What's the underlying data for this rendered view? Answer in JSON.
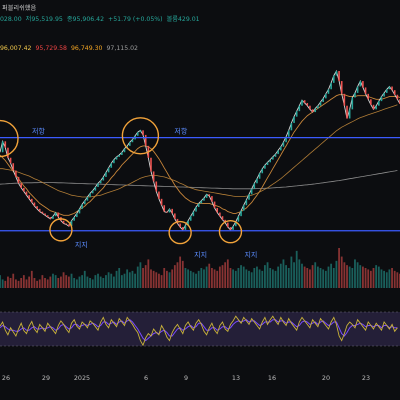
{
  "header": {
    "title_suffix": "퍼블리쉬했음",
    "ohlc": [
      {
        "text": "028.00",
        "color": "#26a69a"
      },
      {
        "text": "저95,519.95",
        "color": "#26a69a"
      },
      {
        "text": "종95,906.42",
        "color": "#26a69a"
      },
      {
        "text": "+51.79 (+0.05%)",
        "color": "#26a69a"
      },
      {
        "text": "볼륨429.01",
        "color": "#26a69a"
      }
    ],
    "ma_values": [
      {
        "text": "96,007.42",
        "color": "#f2c94c"
      },
      {
        "text": "95,729.58",
        "color": "#ef4444"
      },
      {
        "text": "96,749.30",
        "color": "#f5a623"
      },
      {
        "text": "97,115.02",
        "color": "#9e9e9e"
      }
    ]
  },
  "annotations": {
    "resistance_labels": [
      "저항",
      "저항"
    ],
    "support_labels": [
      "지지",
      "지지",
      "지지"
    ]
  },
  "colors": {
    "background": "#0c0d10",
    "up": "#26a69a",
    "down": "#ef5350",
    "level_line": "#3b5bff",
    "marker": "#f2a33a",
    "ma_orange": "#c9863a",
    "ma_gray": "#8d8d8d",
    "oscillator_band": "#2a2442",
    "oscillator_fast": "#c9b23a",
    "oscillator_slow": "#7a4cff"
  },
  "chart_data": {
    "type": "line",
    "x_tick_labels": [
      "26",
      "29",
      "2025",
      "6",
      "9",
      "13",
      "16",
      "20",
      "23"
    ],
    "levels": {
      "resistance": 102400,
      "support": 92200
    },
    "series": [
      {
        "values": [
          100800,
          102000,
          101300,
          100200,
          99600,
          98800,
          98100,
          97400,
          96900,
          96500,
          96100,
          95700,
          95300,
          94900,
          94600,
          94300,
          94100,
          93900,
          93700,
          93500,
          93800,
          94200,
          93700,
          93300,
          93000,
          92900,
          92700,
          93300,
          93700,
          94100,
          94600,
          95100,
          95500,
          95900,
          96300,
          96600,
          97000,
          97400,
          97700,
          98100,
          98600,
          99100,
          99600,
          100000,
          100300,
          100500,
          100800,
          101200,
          101500,
          101900,
          102200,
          102600,
          103000,
          103200,
          102700,
          101500,
          100200,
          98700,
          97600,
          96500,
          95700,
          95000,
          94300,
          94200,
          94600,
          94100,
          93500,
          93000,
          92600,
          92300,
          92800,
          93300,
          93800,
          94300,
          94800,
          95200,
          95500,
          95800,
          96200,
          96000,
          95400,
          94700,
          94200,
          93800,
          93400,
          93100,
          92600,
          92300,
          92700,
          93200,
          93800,
          94400,
          95000,
          95600,
          96200,
          96800,
          97400,
          97900,
          98500,
          99000,
          99400,
          99700,
          100000,
          100300,
          100600,
          101000,
          101400,
          101900,
          102500,
          103200,
          104000,
          104700,
          105300,
          105900,
          106500,
          106200,
          105900,
          105500,
          105200,
          105600,
          105900,
          106300,
          106700,
          107200,
          107700,
          108400,
          109200,
          109700,
          108600,
          107200,
          105900,
          104500,
          105500,
          106800,
          107300,
          108000,
          108600,
          107900,
          107200,
          106600,
          106000,
          105500,
          105900,
          106400,
          106900,
          107300,
          107700,
          108000,
          107600,
          107100,
          106600,
          106100
        ]
      },
      {
        "values": [
          100500,
          100200,
          99900,
          99500,
          99100,
          98700,
          98300,
          97900,
          97500,
          97100,
          96800,
          96400,
          96100,
          95800,
          95500,
          95200,
          95000,
          94800,
          94600,
          94400,
          94300,
          94200,
          94100,
          94000,
          93900,
          93900,
          93900,
          94000,
          94100,
          94300,
          94500,
          94700,
          94900,
          95200,
          95400,
          95700,
          96000,
          96300,
          96600,
          96900,
          97300,
          97600,
          98000,
          98300,
          98700,
          99000,
          99400,
          99700,
          100000,
          100300,
          100600,
          100900,
          101200,
          101400,
          101500,
          101500,
          101400,
          101200,
          100900,
          100500,
          100100,
          99600,
          99100,
          98600,
          98100,
          97700,
          97200,
          96800,
          96400,
          96100,
          95800,
          95600,
          95400,
          95300,
          95200,
          95200,
          95200,
          95200,
          95200,
          95200,
          95100,
          95000,
          94900,
          94800,
          94600,
          94500,
          94300,
          94200,
          94100,
          94100,
          94200,
          94300,
          94500,
          94700,
          95000,
          95300,
          95700,
          96100,
          96500,
          97000,
          97500,
          98000,
          98500,
          99000,
          99500,
          100000,
          100500,
          101000,
          101500,
          102000,
          102500,
          103000,
          103400,
          103800,
          104200,
          104500,
          104800,
          105000,
          105200,
          105400,
          105600,
          105800,
          106000,
          106200,
          106400,
          106600,
          106800,
          107000,
          107100,
          107100,
          107100,
          107000,
          106900,
          106900,
          106900,
          107000,
          107000,
          107000,
          107000,
          106900,
          106800,
          106700,
          106600,
          106600,
          106600,
          106700,
          106800,
          106900,
          106900,
          106900,
          106900,
          106800
        ]
      },
      {
        "values": [
          99000,
          99000,
          98950,
          98900,
          98850,
          98800,
          98700,
          98600,
          98500,
          98400,
          98300,
          98200,
          98050,
          97900,
          97800,
          97650,
          97500,
          97350,
          97200,
          97050,
          96900,
          96750,
          96600,
          96500,
          96400,
          96300,
          96200,
          96100,
          96050,
          96000,
          95950,
          95900,
          95900,
          95900,
          95900,
          95950,
          96000,
          96050,
          96100,
          96200,
          96300,
          96400,
          96500,
          96600,
          96700,
          96800,
          96950,
          97100,
          97200,
          97350,
          97500,
          97650,
          97800,
          97950,
          98050,
          98150,
          98200,
          98250,
          98250,
          98250,
          98200,
          98150,
          98100,
          98000,
          97900,
          97800,
          97700,
          97550,
          97400,
          97300,
          97150,
          97000,
          96900,
          96800,
          96700,
          96650,
          96600,
          96550,
          96500,
          96450,
          96400,
          96350,
          96300,
          96250,
          96200,
          96150,
          96100,
          96050,
          96000,
          95950,
          95950,
          95950,
          95950,
          96000,
          96050,
          96100,
          96200,
          96300,
          96450,
          96600,
          96750,
          96900,
          97100,
          97300,
          97500,
          97700,
          97900,
          98150,
          98400,
          98650,
          98900,
          99150,
          99400,
          99650,
          99900,
          100150,
          100400,
          100650,
          100900,
          101150,
          101400,
          101650,
          101900,
          102150,
          102400,
          102650,
          102900,
          103150,
          103350,
          103550,
          103700,
          103850,
          104000,
          104150,
          104300,
          104450,
          104600,
          104700,
          104800,
          104900,
          105000,
          105100,
          105200,
          105300,
          105400,
          105500,
          105600,
          105700,
          105800,
          105900,
          106000
        ]
      },
      {
        "values": [
          97300,
          97320,
          97340,
          97360,
          97380,
          97400,
          97410,
          97420,
          97430,
          97440,
          97450,
          97455,
          97460,
          97465,
          97470,
          97475,
          97480,
          97480,
          97480,
          97480,
          97480,
          97470,
          97460,
          97450,
          97440,
          97430,
          97420,
          97410,
          97400,
          97390,
          97380,
          97370,
          97360,
          97350,
          97340,
          97330,
          97320,
          97310,
          97300,
          97290,
          97280,
          97270,
          97260,
          97250,
          97240,
          97230,
          97220,
          97210,
          97200,
          97190,
          97180,
          97170,
          97160,
          97150,
          97140,
          97130,
          97120,
          97110,
          97100,
          97090,
          97080,
          97070,
          97060,
          97050,
          97040,
          97030,
          97020,
          97010,
          97000,
          96990,
          96980,
          96970,
          96960,
          96950,
          96940,
          96930,
          96920,
          96910,
          96900,
          96890,
          96880,
          96870,
          96860,
          96850,
          96840,
          96830,
          96820,
          96810,
          96800,
          96800,
          96800,
          96800,
          96800,
          96800,
          96800,
          96800,
          96810,
          96820,
          96830,
          96840,
          96850,
          96860,
          96880,
          96900,
          96920,
          96940,
          96960,
          96980,
          97000,
          97030,
          97060,
          97090,
          97120,
          97150,
          97180,
          97210,
          97240,
          97270,
          97300,
          97340,
          97380,
          97420,
          97460,
          97500,
          97540,
          97580,
          97620,
          97660,
          97700,
          97750,
          97800,
          97850,
          97900,
          97950,
          98000,
          98050,
          98100,
          98150,
          98200,
          98250,
          98300,
          98350,
          98400,
          98450,
          98500,
          98550,
          98600,
          98650,
          98700,
          98750,
          98800
        ]
      }
    ],
    "y_range": [
      89000,
      112000
    ],
    "markers": [
      {
        "x_index": 0,
        "value": 102300,
        "role": "resistance"
      },
      {
        "x_index": 53,
        "value": 102600,
        "role": "resistance"
      },
      {
        "x_index": 23,
        "value": 92300,
        "role": "support"
      },
      {
        "x_index": 68,
        "value": 92000,
        "role": "support"
      },
      {
        "x_index": 87,
        "value": 92100,
        "role": "support"
      }
    ],
    "volume": [
      9,
      6,
      5,
      8,
      7,
      10,
      6,
      5,
      7,
      9,
      6,
      8,
      12,
      7,
      5,
      6,
      9,
      7,
      6,
      8,
      10,
      9,
      7,
      8,
      11,
      9,
      8,
      10,
      7,
      6,
      8,
      9,
      12,
      8,
      7,
      6,
      9,
      10,
      8,
      7,
      9,
      11,
      10,
      8,
      12,
      14,
      9,
      10,
      13,
      11,
      12,
      10,
      15,
      18,
      14,
      16,
      20,
      13,
      12,
      11,
      10,
      9,
      14,
      12,
      11,
      13,
      16,
      18,
      22,
      19,
      14,
      13,
      12,
      11,
      10,
      12,
      14,
      13,
      15,
      17,
      14,
      13,
      12,
      15,
      16,
      18,
      20,
      14,
      13,
      12,
      14,
      16,
      15,
      13,
      12,
      11,
      14,
      15,
      13,
      12,
      16,
      18,
      14,
      13,
      12,
      15,
      17,
      20,
      16,
      14,
      22,
      18,
      26,
      20,
      17,
      15,
      14,
      13,
      16,
      18,
      15,
      14,
      13,
      12,
      15,
      17,
      14,
      19,
      28,
      22,
      18,
      16,
      15,
      14,
      20,
      18,
      16,
      15,
      14,
      13,
      12,
      14,
      16,
      15,
      13,
      12,
      11,
      13,
      14,
      12,
      11,
      10
    ],
    "oscillator": {
      "fast": [
        55,
        62,
        48,
        40,
        52,
        45,
        38,
        50,
        60,
        47,
        42,
        55,
        63,
        50,
        44,
        58,
        52,
        46,
        60,
        54,
        48,
        42,
        56,
        64,
        58,
        50,
        44,
        60,
        66,
        55,
        50,
        62,
        58,
        52,
        64,
        60,
        54,
        48,
        62,
        70,
        58,
        52,
        66,
        60,
        54,
        68,
        62,
        56,
        70,
        64,
        58,
        50,
        44,
        30,
        22,
        35,
        42,
        38,
        50,
        44,
        40,
        56,
        48,
        36,
        30,
        44,
        52,
        58,
        50,
        42,
        56,
        62,
        54,
        48,
        60,
        66,
        58,
        46,
        40,
        52,
        60,
        48,
        42,
        56,
        62,
        50,
        46,
        58,
        64,
        72,
        66,
        60,
        70,
        64,
        58,
        68,
        62,
        56,
        50,
        62,
        70,
        58,
        66,
        72,
        64,
        58,
        70,
        62,
        56,
        68,
        60,
        54,
        48,
        62,
        70,
        64,
        58,
        52,
        66,
        60,
        54,
        68,
        62,
        56,
        50,
        62,
        70,
        58,
        38,
        30,
        42,
        56,
        62,
        58,
        52,
        66,
        60,
        54,
        48,
        62,
        56,
        50,
        60,
        54,
        48,
        62,
        56,
        50,
        58,
        46,
        52
      ],
      "slow": [
        52,
        56,
        54,
        50,
        48,
        48,
        46,
        46,
        50,
        52,
        48,
        48,
        52,
        54,
        50,
        50,
        52,
        50,
        52,
        54,
        52,
        48,
        50,
        56,
        58,
        54,
        50,
        52,
        58,
        58,
        54,
        56,
        58,
        56,
        58,
        60,
        58,
        54,
        56,
        62,
        62,
        58,
        60,
        62,
        58,
        62,
        64,
        60,
        64,
        66,
        62,
        56,
        50,
        42,
        34,
        30,
        34,
        38,
        42,
        44,
        42,
        46,
        48,
        44,
        38,
        38,
        44,
        50,
        52,
        48,
        50,
        54,
        56,
        52,
        54,
        60,
        60,
        54,
        48,
        48,
        52,
        52,
        48,
        50,
        54,
        54,
        50,
        52,
        58,
        62,
        64,
        62,
        64,
        66,
        62,
        64,
        64,
        60,
        56,
        58,
        62,
        62,
        62,
        66,
        66,
        62,
        64,
        64,
        60,
        62,
        62,
        58,
        54,
        56,
        62,
        64,
        62,
        58,
        60,
        62,
        58,
        62,
        64,
        60,
        56,
        58,
        62,
        62,
        52,
        42,
        38,
        44,
        52,
        56,
        56,
        58,
        60,
        58,
        54,
        56,
        56,
        54,
        56,
        56,
        52,
        56,
        56,
        52,
        54,
        52,
        52
      ]
    }
  }
}
